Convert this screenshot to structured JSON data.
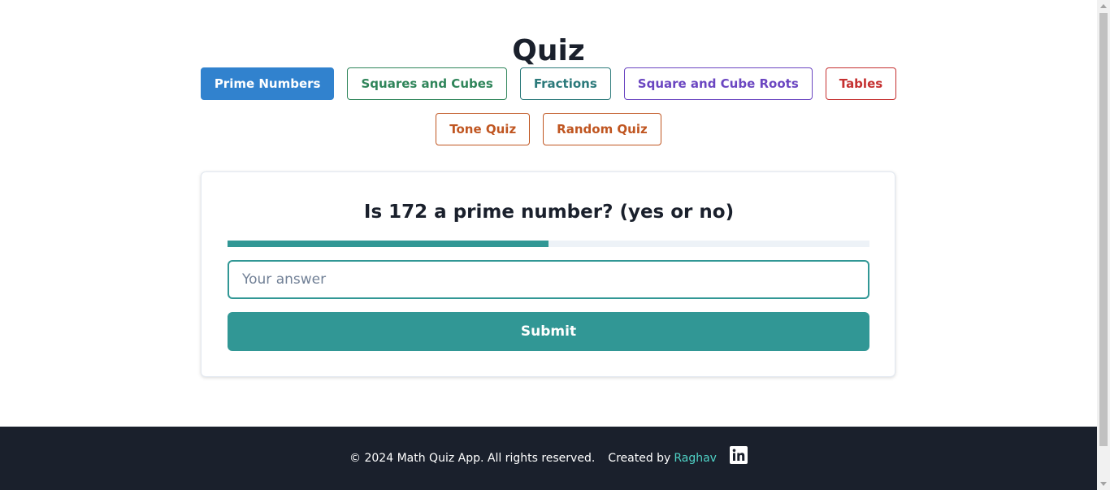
{
  "page": {
    "title": "Quiz"
  },
  "nav": {
    "buttons": [
      {
        "label": "Prime Numbers",
        "color": "#3182ce",
        "active": true
      },
      {
        "label": "Squares and Cubes",
        "color": "#2f855a"
      },
      {
        "label": "Fractions",
        "color": "#2c7a7b"
      },
      {
        "label": "Square and Cube Roots",
        "color": "#6b46c1"
      },
      {
        "label": "Tables",
        "color": "#c53030"
      },
      {
        "label": "Tone Quiz",
        "color": "#c05621"
      },
      {
        "label": "Random Quiz",
        "color": "#c05621"
      }
    ]
  },
  "quiz": {
    "question": "Is 172 a prime number? (yes or no)",
    "progress": 0.5,
    "answer_placeholder": "Your answer",
    "answer_value": "",
    "submit_label": "Submit",
    "accent_color": "#319795"
  },
  "footer": {
    "copyright": "© 2024 Math Quiz App. All rights reserved.",
    "created_by": "Created by",
    "author": "Raghav",
    "social_icon": "linkedin-icon"
  }
}
